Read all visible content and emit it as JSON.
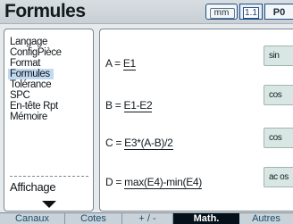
{
  "header": {
    "title": "Formules",
    "unit_button": "mm",
    "display_icon_label": "1.1",
    "print_button": "P0"
  },
  "sidebar": {
    "items": [
      {
        "label": "Langage"
      },
      {
        "label": "ConfigPièce"
      },
      {
        "label": "Format"
      },
      {
        "label": "Formules",
        "selected": true
      },
      {
        "label": "Tolérance"
      },
      {
        "label": "SPC"
      },
      {
        "label": "En-tête Rpt"
      },
      {
        "label": "Mémoire"
      }
    ],
    "lower_item": "Affichage"
  },
  "formulas": [
    {
      "variable": "A",
      "expression": "E1",
      "function_button": "sin"
    },
    {
      "variable": "B",
      "expression": "E1-E2",
      "function_button": "cos"
    },
    {
      "variable": "C",
      "expression": "E3*(A-B)/2",
      "function_button": "cos"
    },
    {
      "variable": "D",
      "expression": "max(E4)-min(E4)",
      "function_button": "ac os"
    }
  ],
  "tabs": [
    {
      "label": "Canaux"
    },
    {
      "label": "Cotes"
    },
    {
      "label": "+ / -"
    },
    {
      "label": "Math.",
      "active": true
    },
    {
      "label": "Autres"
    }
  ],
  "colors": {
    "accent_selected": "#c2d9f2",
    "active_tab": "#05111a",
    "function_button_bg": "#d9e7e4"
  }
}
